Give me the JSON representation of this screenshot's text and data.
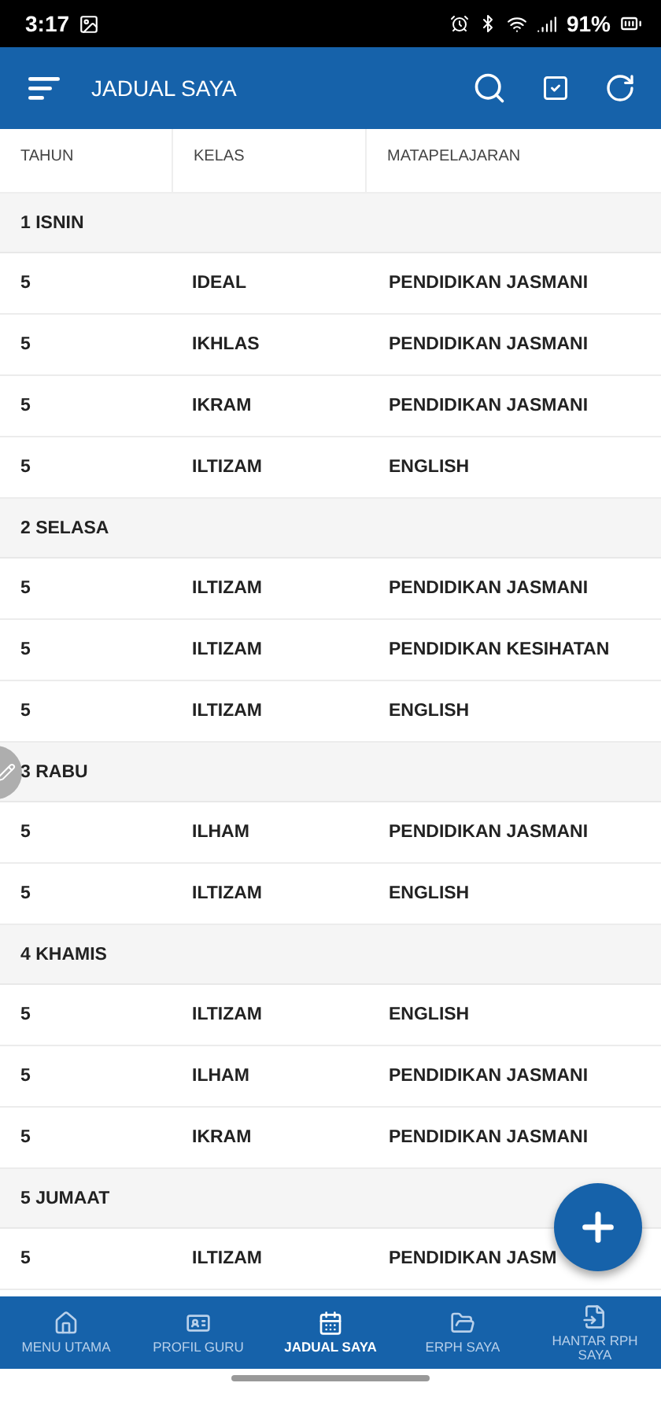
{
  "status_bar": {
    "time": "3:17",
    "battery": "91%"
  },
  "app_bar": {
    "title": "JADUAL SAYA"
  },
  "table": {
    "columns": [
      "TAHUN",
      "KELAS",
      "MATAPELAJARAN"
    ],
    "sections": [
      {
        "title": "1 ISNIN",
        "rows": [
          [
            "5",
            "IDEAL",
            "PENDIDIKAN JASMANI"
          ],
          [
            "5",
            "IKHLAS",
            "PENDIDIKAN JASMANI"
          ],
          [
            "5",
            "IKRAM",
            "PENDIDIKAN JASMANI"
          ],
          [
            "5",
            "ILTIZAM",
            "ENGLISH"
          ]
        ]
      },
      {
        "title": "2 SELASA",
        "rows": [
          [
            "5",
            "ILTIZAM",
            "PENDIDIKAN JASMANI"
          ],
          [
            "5",
            "ILTIZAM",
            "PENDIDIKAN KESIHATAN"
          ],
          [
            "5",
            "ILTIZAM",
            "ENGLISH"
          ]
        ]
      },
      {
        "title": "3 RABU",
        "rows": [
          [
            "5",
            "ILHAM",
            "PENDIDIKAN JASMANI"
          ],
          [
            "5",
            "ILTIZAM",
            "ENGLISH"
          ]
        ]
      },
      {
        "title": "4 KHAMIS",
        "rows": [
          [
            "5",
            "ILTIZAM",
            "ENGLISH"
          ],
          [
            "5",
            "ILHAM",
            "PENDIDIKAN JASMANI"
          ],
          [
            "5",
            "IKRAM",
            "PENDIDIKAN JASMANI"
          ]
        ]
      },
      {
        "title": "5 JUMAAT",
        "rows": [
          [
            "5",
            "ILTIZAM",
            "PENDIDIKAN JASM"
          ]
        ]
      }
    ]
  },
  "bottom_nav": [
    {
      "label": "MENU UTAMA",
      "selected": false
    },
    {
      "label": "PROFIL GURU",
      "selected": false
    },
    {
      "label": "JADUAL SAYA",
      "selected": true
    },
    {
      "label": "ERPH SAYA",
      "selected": false
    },
    {
      "label": "HANTAR RPH SAYA",
      "selected": false
    }
  ]
}
